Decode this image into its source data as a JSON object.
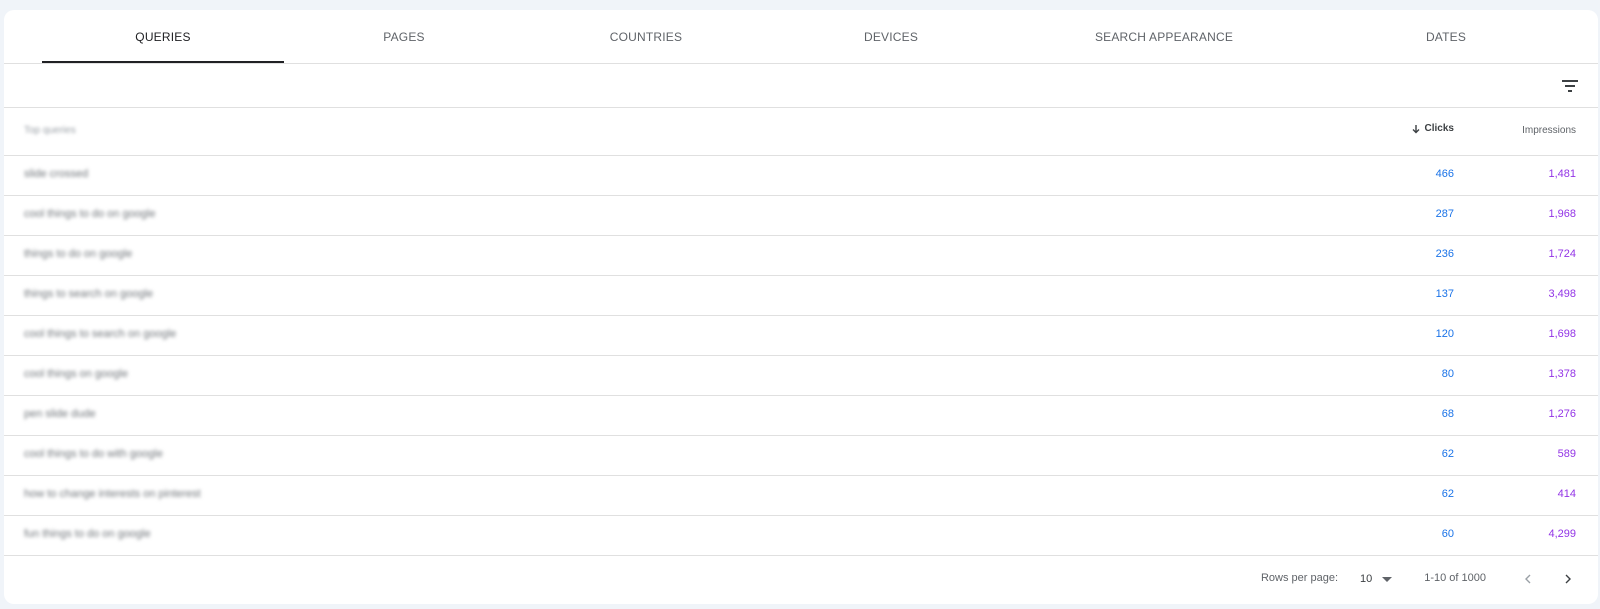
{
  "tabs": [
    {
      "label": "QUERIES",
      "active": true
    },
    {
      "label": "PAGES"
    },
    {
      "label": "COUNTRIES"
    },
    {
      "label": "DEVICES"
    },
    {
      "label": "SEARCH APPEARANCE"
    },
    {
      "label": "DATES"
    }
  ],
  "filter": {
    "icon": "filter-icon"
  },
  "table": {
    "headers": {
      "query": "Top queries",
      "clicks": "Clicks",
      "impressions": "Impressions",
      "sort_icon": "arrow-down-icon"
    },
    "rows": [
      {
        "query": "slide crossed",
        "clicks": "466",
        "impressions": "1,481"
      },
      {
        "query": "cool things to do on google",
        "clicks": "287",
        "impressions": "1,968"
      },
      {
        "query": "things to do on google",
        "clicks": "236",
        "impressions": "1,724"
      },
      {
        "query": "things to search on google",
        "clicks": "137",
        "impressions": "3,498"
      },
      {
        "query": "cool things to search on google",
        "clicks": "120",
        "impressions": "1,698"
      },
      {
        "query": "cool things on google",
        "clicks": "80",
        "impressions": "1,378"
      },
      {
        "query": "pen slide dude",
        "clicks": "68",
        "impressions": "1,276"
      },
      {
        "query": "cool things to do with google",
        "clicks": "62",
        "impressions": "589"
      },
      {
        "query": "how to change interests on pinterest",
        "clicks": "62",
        "impressions": "414"
      },
      {
        "query": "fun things to do on google",
        "clicks": "60",
        "impressions": "4,299"
      }
    ]
  },
  "footer": {
    "rows_per_page_label": "Rows per page:",
    "rows_per_page_value": "10",
    "range": "1-10 of 1000",
    "prev_icon": "chevron-left-icon",
    "next_icon": "chevron-right-icon"
  },
  "colors": {
    "clicks": "#1a73e8",
    "impressions": "#9334e6",
    "background": "#f0f4f9"
  }
}
